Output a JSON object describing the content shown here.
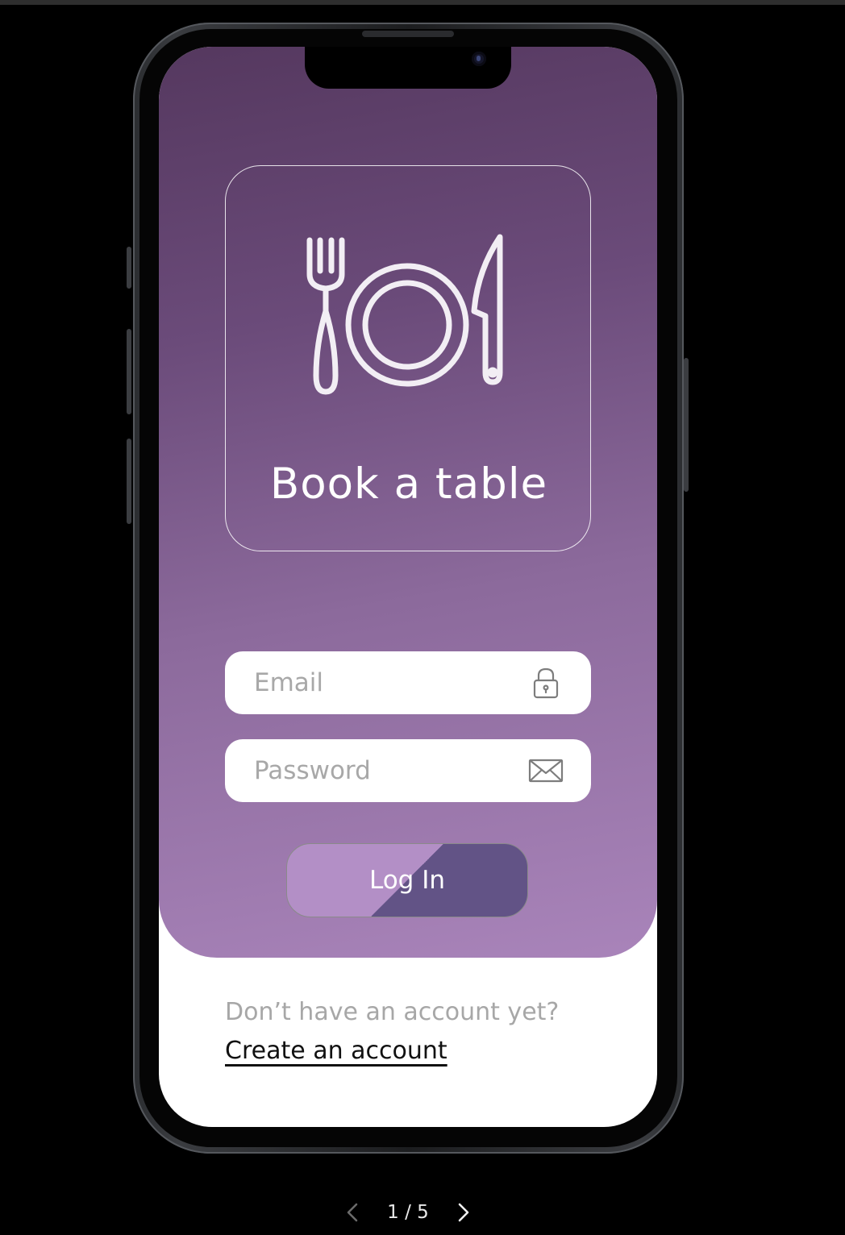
{
  "app": {
    "brand_title": "Book a table",
    "brand_icon": "plate-fork-knife-icon"
  },
  "form": {
    "email_placeholder": "Email",
    "email_icon": "lock-icon",
    "password_placeholder": "Password",
    "password_icon": "envelope-icon",
    "login_label": "Log In"
  },
  "footer": {
    "prompt": "Don’t have an account yet?",
    "link": "Create an account"
  },
  "pager": {
    "current": 1,
    "total": 5,
    "label": "1 / 5"
  },
  "colors": {
    "gradient_top": "#55385f",
    "gradient_bottom": "#a984ba",
    "button_light": "#b38fc6",
    "button_dark": "#625386"
  }
}
